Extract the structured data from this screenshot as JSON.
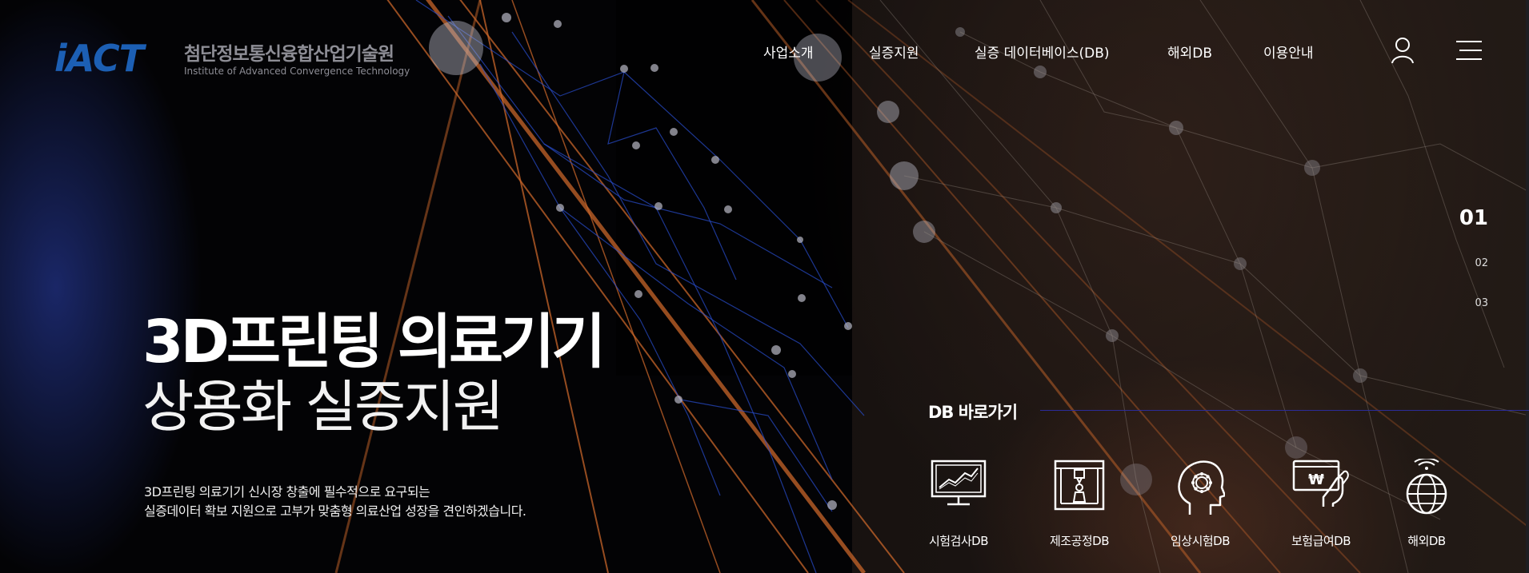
{
  "brand": {
    "logo_mark": "iACT",
    "name_ko": "첨단정보통신융합산업기술원",
    "name_en": "Institute of Advanced Convergence Technology"
  },
  "nav": {
    "items": [
      "사업소개",
      "실증지원",
      "실증 데이터베이스(DB)",
      "해외DB",
      "이용안내"
    ],
    "user_icon": "user-icon",
    "menu_icon": "hamburger-menu-icon"
  },
  "pager": {
    "slides": [
      "01",
      "02",
      "03"
    ],
    "active": "01"
  },
  "hero": {
    "title_line1": "3D프린팅 의료기기",
    "title_line2": "상용화 실증지원",
    "desc_line1": "3D프린팅 의료기기 신시장 창출에 필수적으로 요구되는",
    "desc_line2": "실증데이터 확보 지원으로 고부가 맞춤형 의료산업 성장을 견인하겠습니다."
  },
  "db_shortcuts": {
    "title": "DB 바로가기",
    "items": [
      {
        "label": "시험검사DB",
        "icon": "monitor-chart-icon"
      },
      {
        "label": "제조공정DB",
        "icon": "3d-printer-icon"
      },
      {
        "label": "임상시험DB",
        "icon": "head-gear-icon"
      },
      {
        "label": "보험급여DB",
        "icon": "hand-won-card-icon"
      },
      {
        "label": "해외DB",
        "icon": "globe-wifi-icon"
      }
    ]
  },
  "colors": {
    "logo_blue": "#1c5fb4",
    "logo_gray": "#8d8d95",
    "accent_line": "#2b2c9a",
    "network_orange": "#c8652a",
    "network_blue": "#2a4fd0"
  }
}
